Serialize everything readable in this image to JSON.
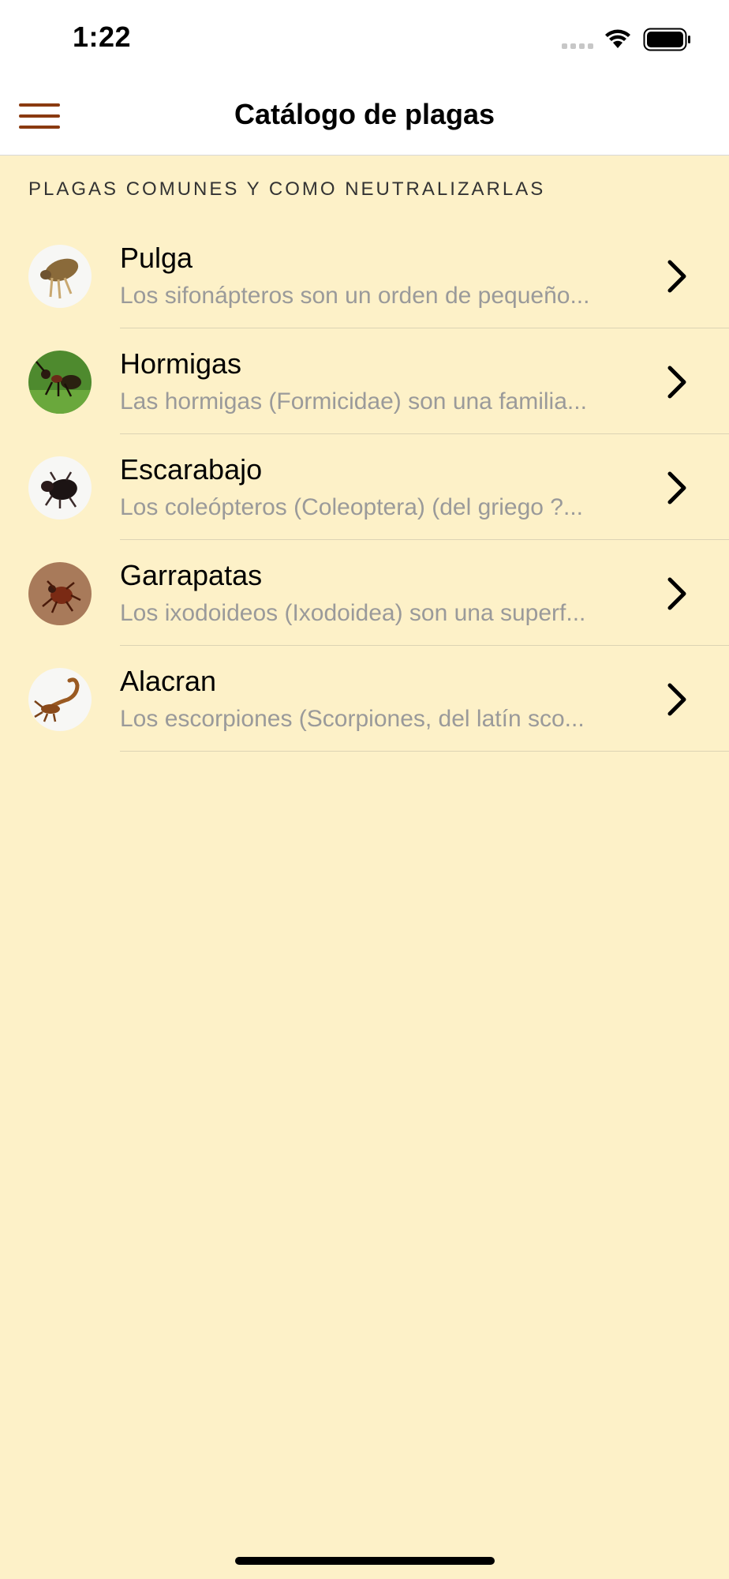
{
  "status_bar": {
    "time": "1:22"
  },
  "nav": {
    "title": "Catálogo de plagas",
    "menu_icon": "hamburger-menu-icon",
    "accent_color": "#8a3a10"
  },
  "section": {
    "header": "PLAGAS COMUNES Y COMO NEUTRALIZARLAS"
  },
  "pests": [
    {
      "title": "Pulga",
      "subtitle": "Los sifonápteros son un orden de pequeño...",
      "icon": "flea-icon"
    },
    {
      "title": "Hormigas",
      "subtitle": "Las hormigas (Formicidae) son una familia...",
      "icon": "ant-icon"
    },
    {
      "title": "Escarabajo",
      "subtitle": "Los coleópteros (Coleoptera) (del griego ?...",
      "icon": "beetle-icon"
    },
    {
      "title": "Garrapatas",
      "subtitle": "Los ixodoideos (Ixodoidea) son una superf...",
      "icon": "tick-icon"
    },
    {
      "title": "Alacran",
      "subtitle": "Los escorpiones (Scorpiones, del latín sco...",
      "icon": "scorpion-icon"
    }
  ],
  "colors": {
    "background": "#fdf1c8",
    "subtitle": "#9a9a9a"
  }
}
